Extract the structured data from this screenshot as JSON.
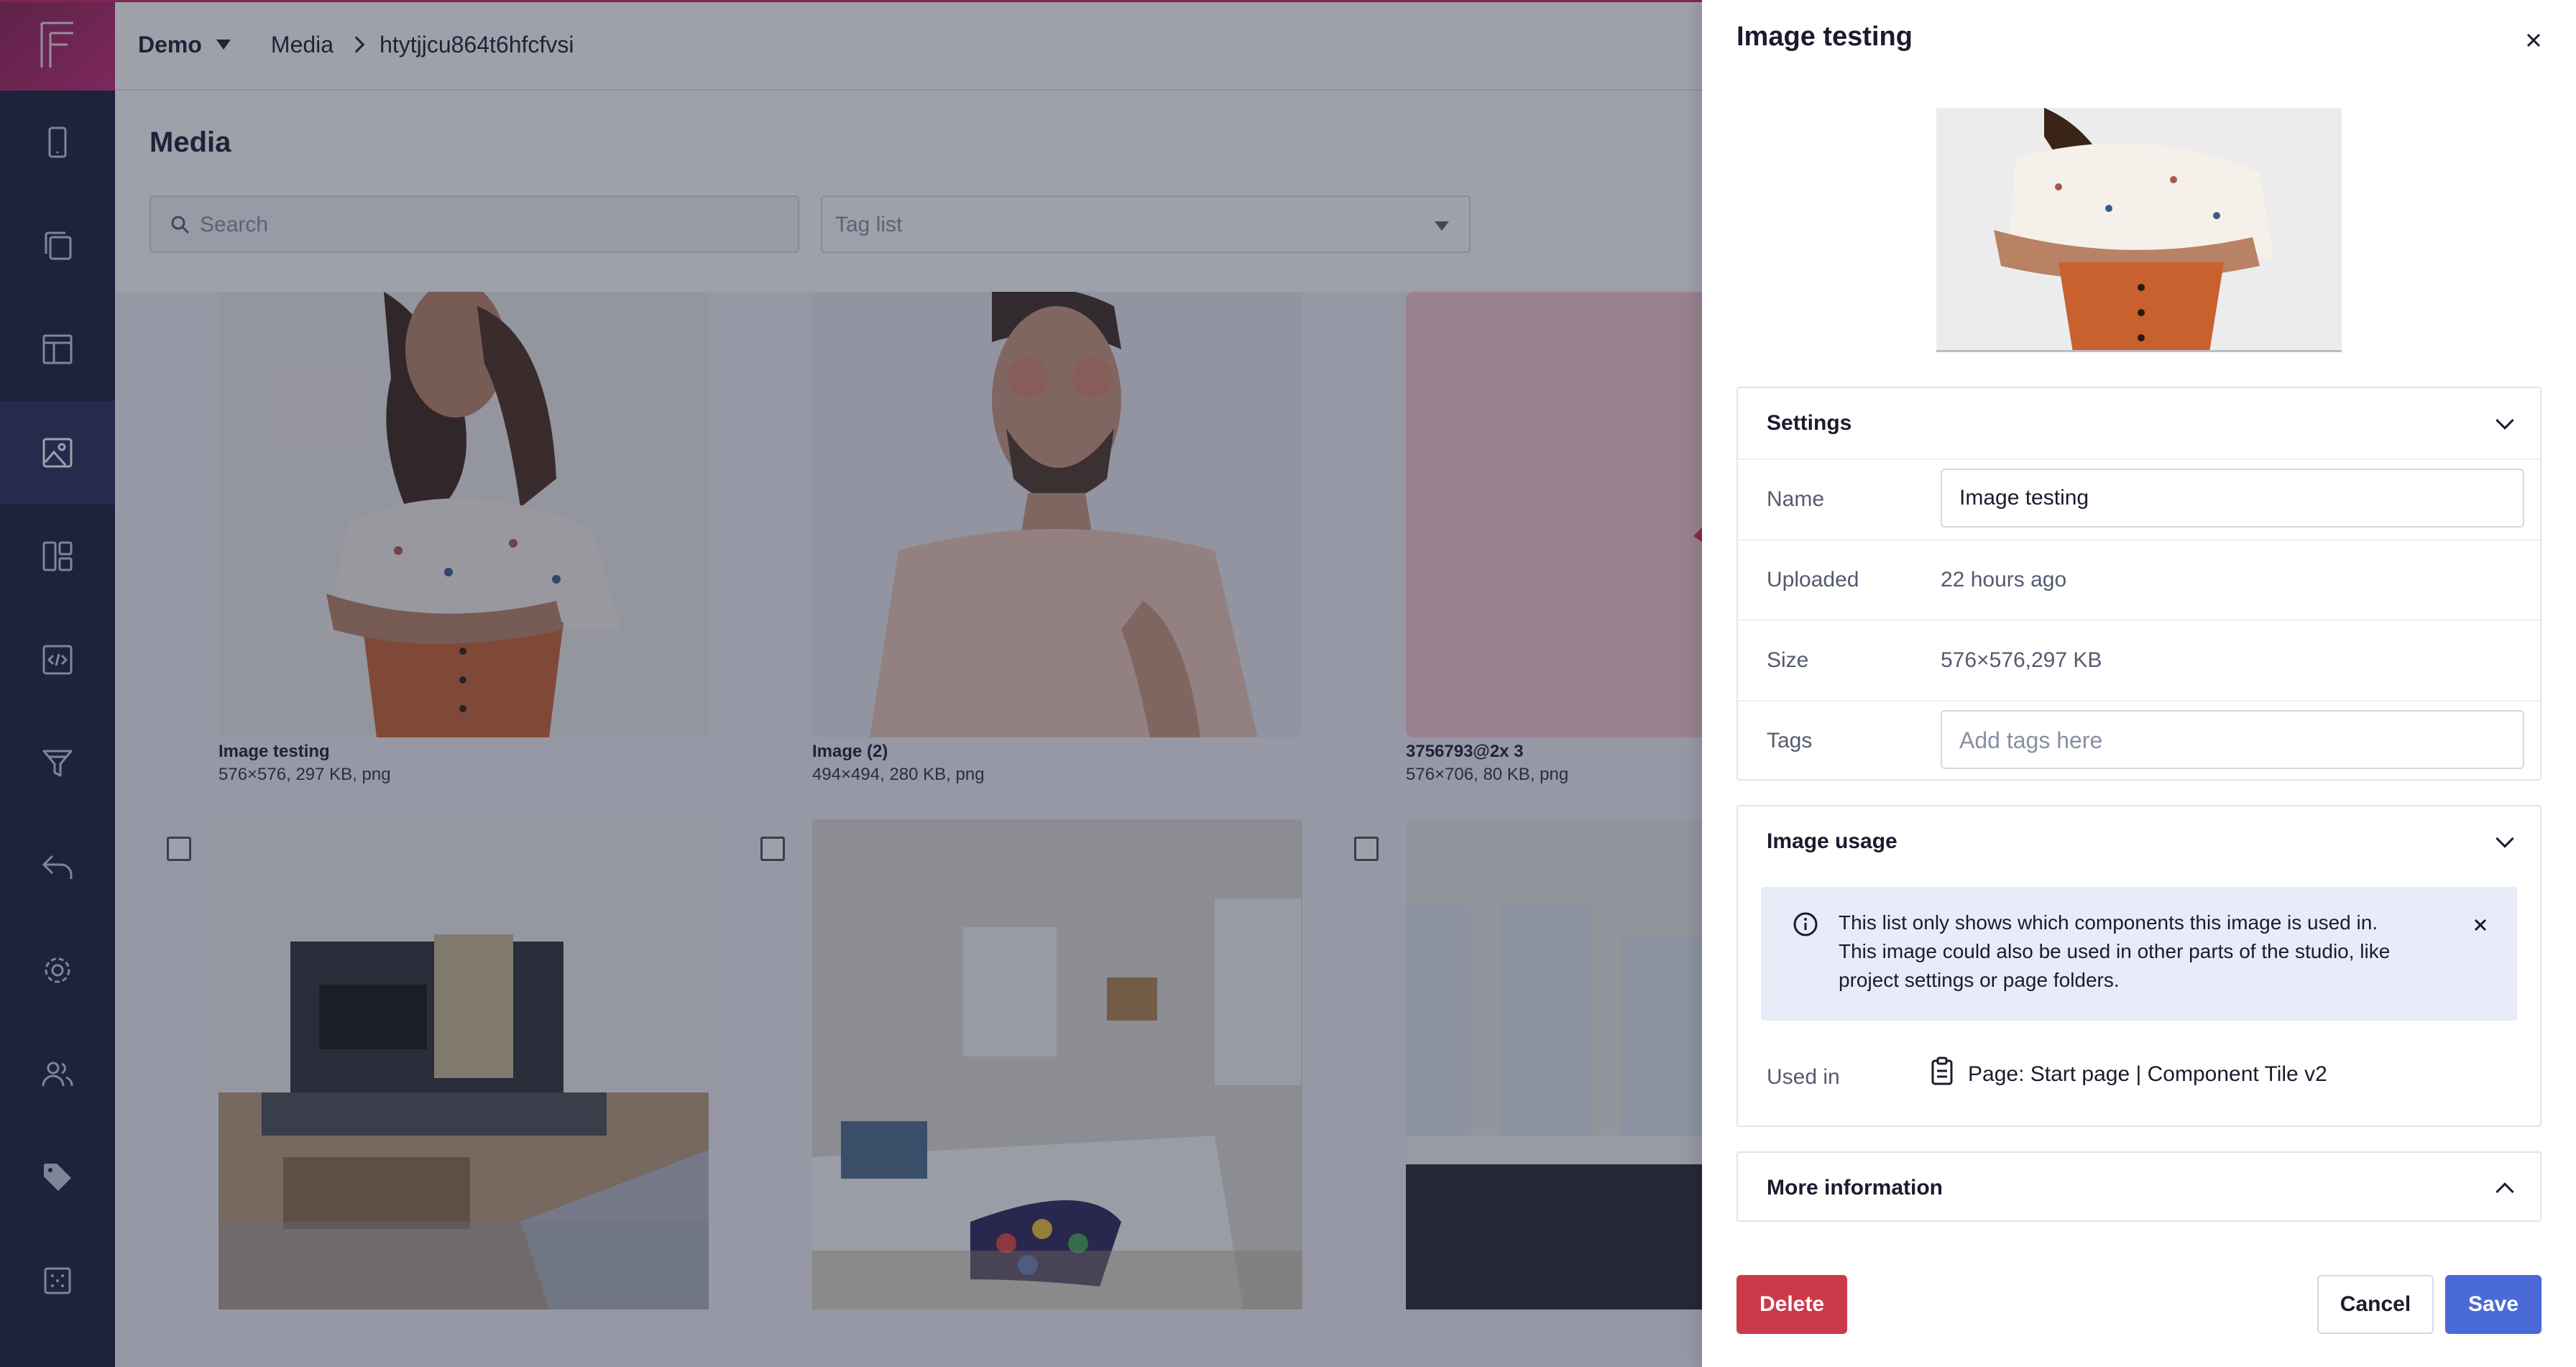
{
  "topbar": {
    "workspace": "Demo",
    "breadcrumb": [
      "Media",
      "htytjjcu864t6hfcfvsi"
    ]
  },
  "sidebar": {
    "icons": [
      "mobile-icon",
      "pages-icon",
      "layout-icon",
      "media-icon",
      "components-icon",
      "code-icon",
      "filter-icon",
      "undo-icon",
      "settings-icon",
      "users-icon",
      "tag-icon",
      "grid-icon"
    ],
    "active": "media-icon"
  },
  "media": {
    "title": "Media",
    "search_placeholder": "Search",
    "taglist_placeholder": "Tag list",
    "items": [
      {
        "title": "Image testing",
        "meta": "576×576, 297 KB, png"
      },
      {
        "title": "Image (2)",
        "meta": "494×494, 280 KB, png"
      },
      {
        "title": "3756793@2x 3",
        "meta": "576×706, 80 KB, png"
      }
    ]
  },
  "panel": {
    "title": "Image testing",
    "settings": {
      "heading": "Settings",
      "name_label": "Name",
      "name_value": "Image testing",
      "uploaded_label": "Uploaded",
      "uploaded_value": "22 hours ago",
      "size_label": "Size",
      "size_value": "576×576,297 KB",
      "tags_label": "Tags",
      "tags_placeholder": "Add tags here"
    },
    "usage": {
      "heading": "Image usage",
      "info": "This list only shows which components this image is used in. This image could also be used in other parts of the studio, like project settings or page folders.",
      "used_in_label": "Used in",
      "used_in_value": "Page: Start page | Component Tile v2"
    },
    "more_info": {
      "heading": "More information"
    },
    "buttons": {
      "delete": "Delete",
      "cancel": "Cancel",
      "save": "Save"
    }
  },
  "colors": {
    "rail": "#161a3a",
    "brand": "#c2256f",
    "delete": "#cc3a4a",
    "save": "#4a6ad8",
    "info_bg": "#e8ecf8"
  }
}
